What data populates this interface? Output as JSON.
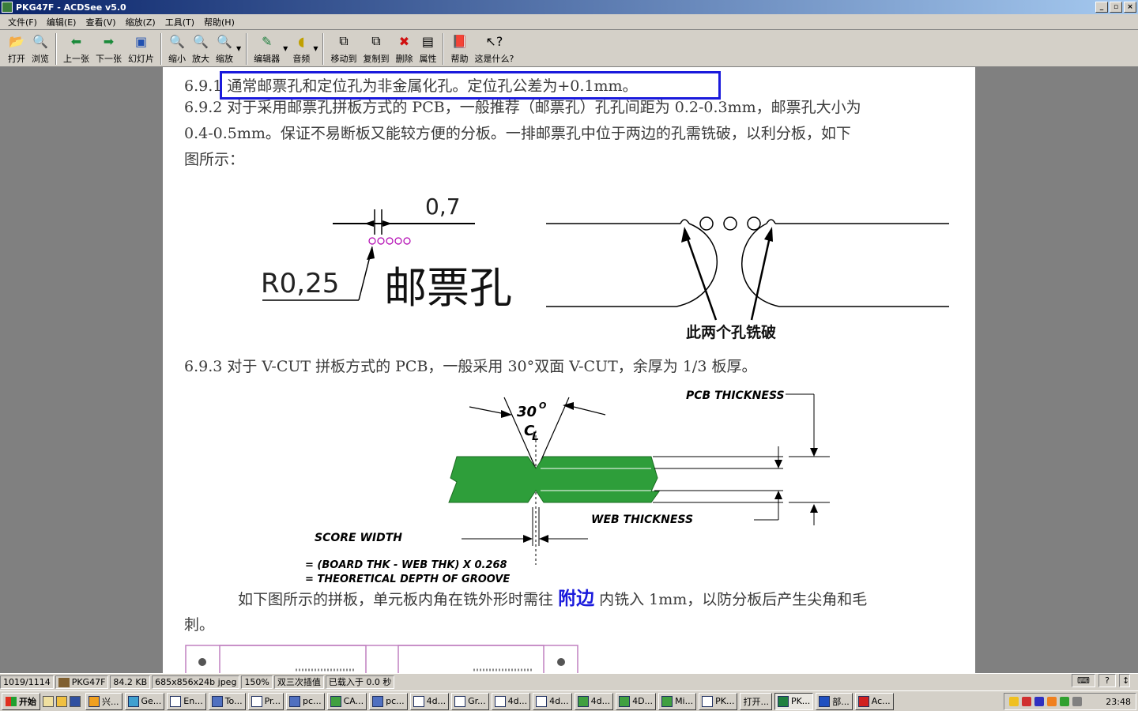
{
  "window": {
    "title": "PKG47F - ACDSee v5.0"
  },
  "menu": [
    "文件(F)",
    "编辑(E)",
    "查看(V)",
    "缩放(Z)",
    "工具(T)",
    "帮助(H)"
  ],
  "toolbar": {
    "open": "打开",
    "browse": "浏览",
    "prev": "上一张",
    "next": "下一张",
    "slideshow": "幻灯片",
    "zoom_out": "缩小",
    "zoom_in": "放大",
    "zoom": "缩放",
    "editor": "编辑器",
    "audio": "音频",
    "move_to": "移动到",
    "copy_to": "复制到",
    "delete": "删除",
    "properties": "属性",
    "help": "帮助",
    "whats_this": "这是什么?"
  },
  "doc": {
    "p691": "6.9.1 通常邮票孔和定位孔为非金属化孔。定位孔公差为+0.1mm。",
    "p692_l1": "6.9.2  对于采用邮票孔拼板方式的 PCB，一般推荐（邮票孔）孔孔间距为 0.2-0.3mm，邮票孔大小为",
    "p692_l2": "0.4-0.5mm。保证不易断板又能较方便的分板。一排邮票孔中位于两边的孔需铣破，以利分板，如下",
    "p692_l3": "图所示：",
    "fig1_dim": "0,7",
    "fig1_radius": "R0,25",
    "fig1_label": "邮票孔",
    "fig1_mill": "此两个孔铣破",
    "p693": "6.9.3  对于 V-CUT 拼板方式的 PCB，一般采用 30°双面 V-CUT，余厚为 1/3 板厚。",
    "fig2_angle": "30",
    "fig2_angle_sup": "O",
    "fig2_cl": "C",
    "fig2_cl_sub": "L",
    "fig2_pcb": "PCB THICKNESS",
    "fig2_web": "WEB THICKNESS",
    "fig2_score": "SCORE WIDTH",
    "fig2_formula1": "= (BOARD THK - WEB THK) X 0.268",
    "fig2_formula2": "= THEORETICAL DEPTH OF GROOVE",
    "p694_a": "如下图所示的拼板，单元板内角在铣外形时需往",
    "p694_emph": "附边",
    "p694_b": "内铣入 1mm，以防分板后产生尖角和毛",
    "p694_l2": "刺。"
  },
  "status": {
    "index": "1019/1114",
    "filename": "PKG47F",
    "size": "84.2 KB",
    "dims": "685x856x24b jpeg",
    "zoom": "150%",
    "filter": "双三次插值",
    "load": "已载入于 0.0 秒"
  },
  "taskbar": {
    "start": "开始",
    "tasks": [
      "兴...",
      "Ge...",
      "En...",
      "To...",
      "Pr...",
      "pc...",
      "CA...",
      "pc...",
      "4d...",
      "Gr...",
      "4d...",
      "4d...",
      "4d...",
      "4D...",
      "Mi...",
      "PK...",
      "打开...",
      "PK...",
      "部...",
      "Ac..."
    ],
    "clock": "23:48"
  },
  "colors": {
    "highlight_box": "#1a1adc",
    "board_green": "#2e9e3a",
    "stamp_hole": "#b000b0",
    "emph_text": "#1a1adc"
  }
}
